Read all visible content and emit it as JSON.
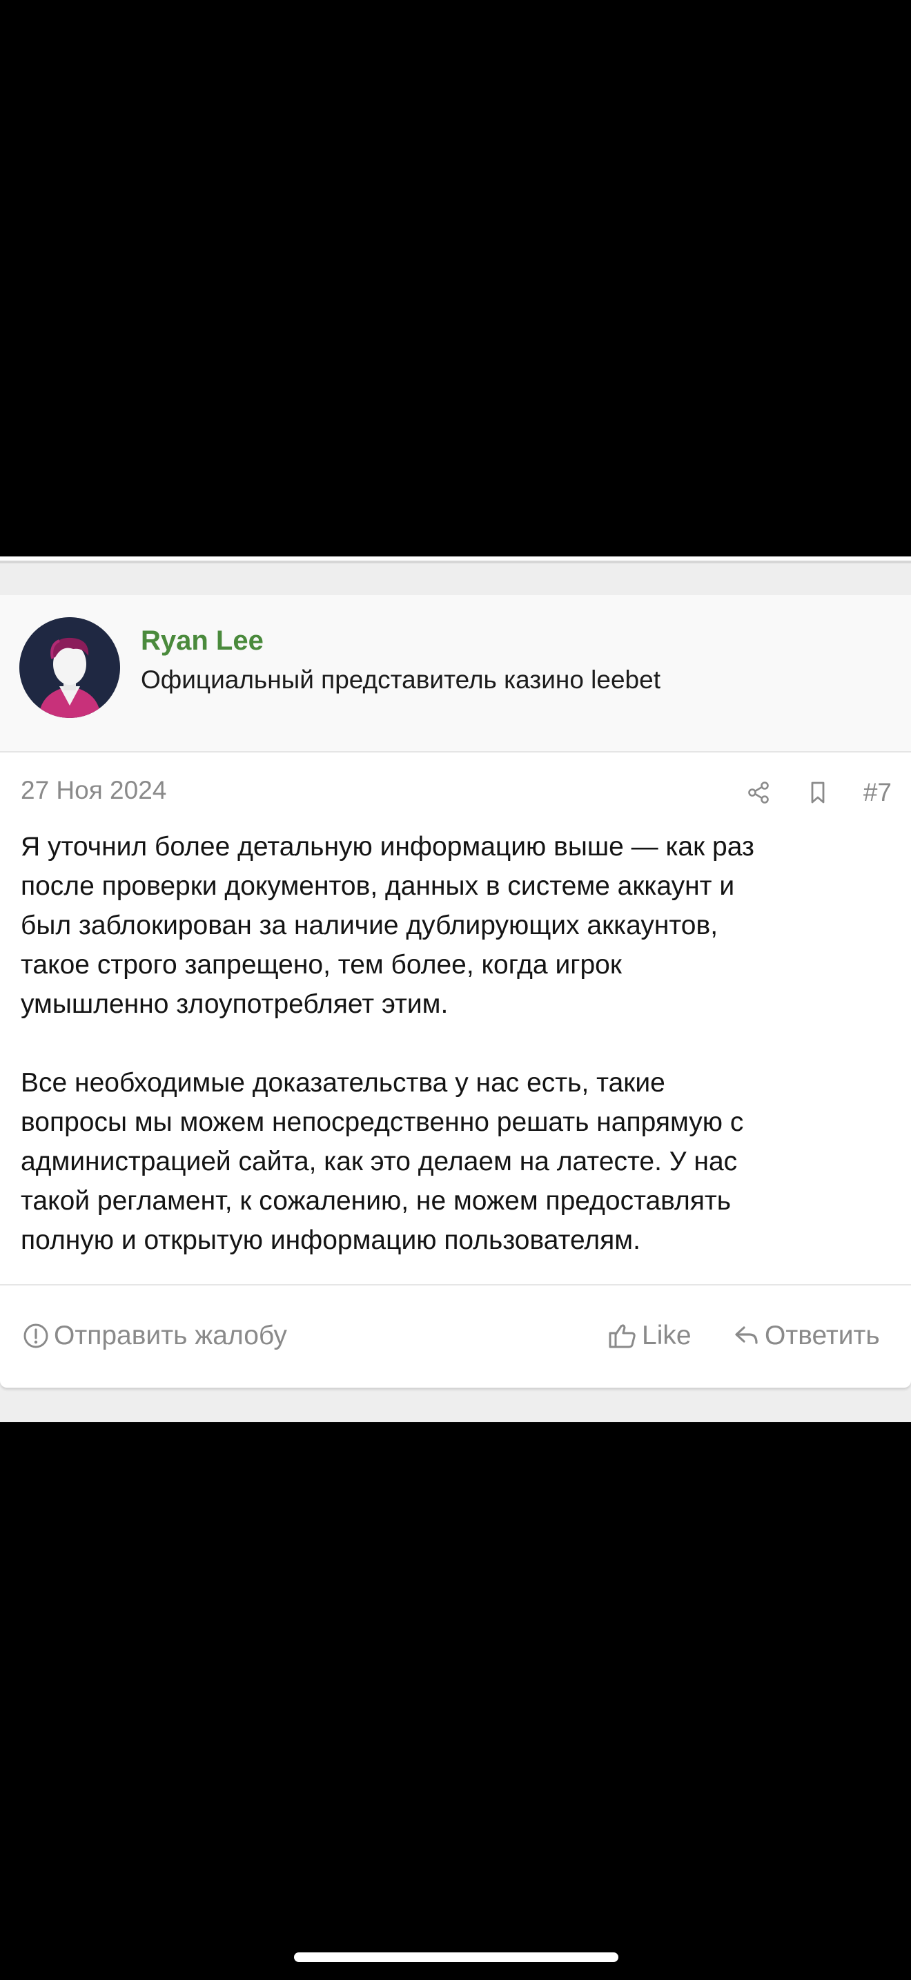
{
  "author": {
    "name": "Ryan Lee",
    "title": "Официальный представитель казино leebet"
  },
  "post": {
    "date": "27 Ноя 2024",
    "number": "#7",
    "paragraphs": [
      [
        "Я уточнил более детальную информацию выше — как раз",
        "после проверки документов, данных в системе аккаунт и",
        "был заблокирован за наличие дублирующих аккаунтов,",
        "такое строго запрещено, тем более, когда игрок",
        "умышленно злоупотребляет этим."
      ],
      [
        "Все необходимые доказательства у нас есть, такие",
        "вопросы мы можем непосредственно решать напрямую с",
        "администрацией сайта, как это делаем на латесте. У нас",
        "такой регламент, к сожалению, не можем предоставлять",
        "полную и открытую информацию пользователям."
      ]
    ]
  },
  "footer": {
    "report_label": "Отправить жалобу",
    "like_label": "Like",
    "reply_label": "Ответить"
  },
  "icons": {
    "share": "share-icon",
    "bookmark": "bookmark-icon",
    "report": "exclamation-circle-icon",
    "like": "thumbs-up-icon",
    "reply": "reply-arrow-icon"
  },
  "colors": {
    "author_name": "#4a8a3c",
    "muted": "#8a8a8a",
    "text": "#141414",
    "background": "#eeeeee"
  }
}
